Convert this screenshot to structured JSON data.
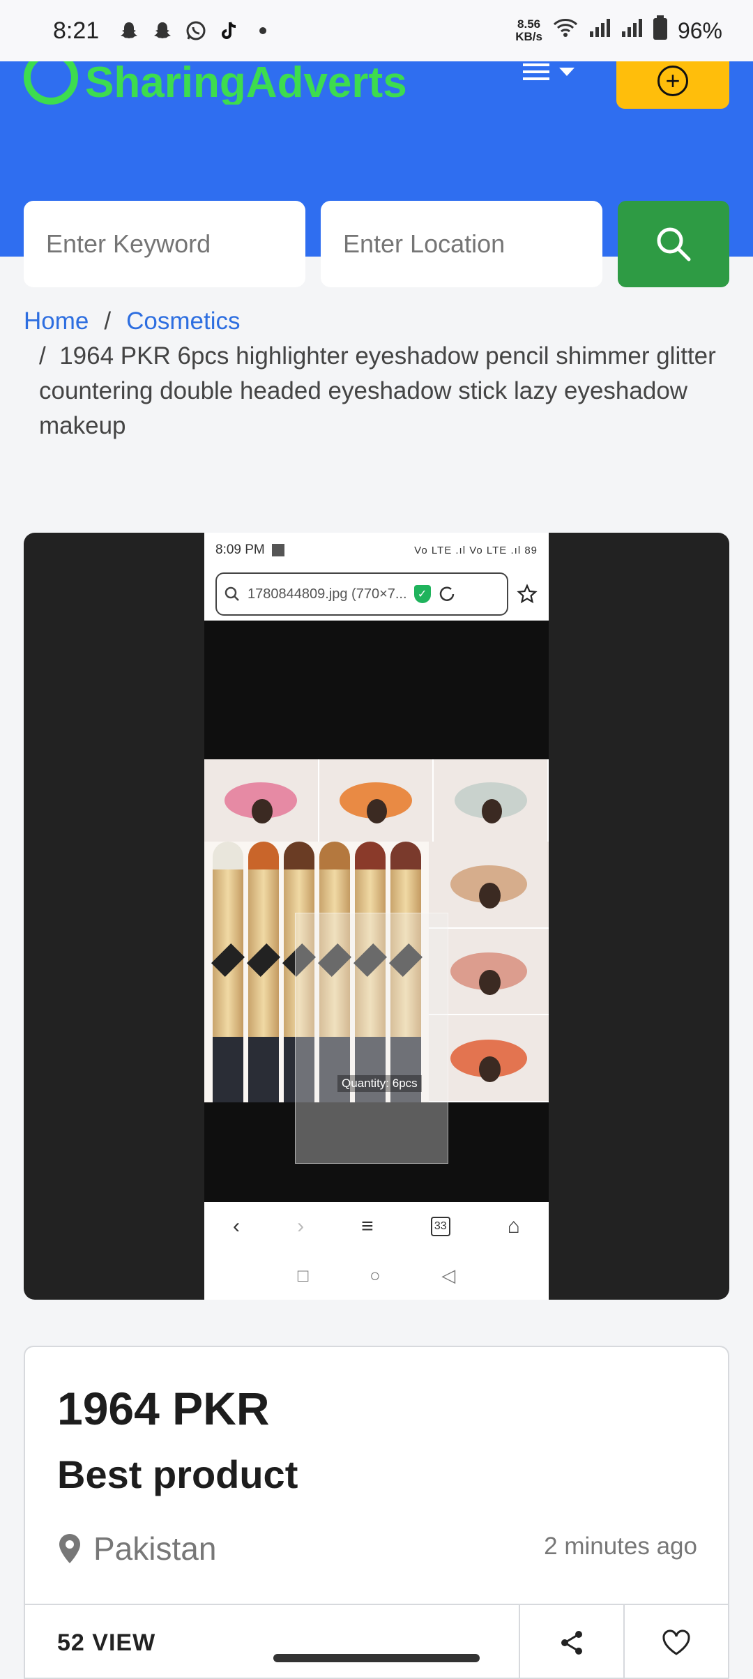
{
  "status_bar": {
    "time": "8:21",
    "net_speed_value": "8.56",
    "net_speed_unit": "KB/s",
    "battery": "96%"
  },
  "header": {
    "logo_text": "SharingAdverts",
    "keyword_placeholder": "Enter Keyword",
    "location_placeholder": "Enter Location",
    "accent": "#2f6ef0",
    "post_button_color": "#ffbe0b",
    "search_button_color": "#2e9b44"
  },
  "breadcrumb": {
    "home": "Home",
    "separator": "/",
    "category": "Cosmetics",
    "current": "1964 PKR 6pcs highlighter eyeshadow pencil shimmer glitter countering double headed eyeshadow stick lazy eyeshadow makeup"
  },
  "gallery": {
    "inner_time": "8:09 PM",
    "inner_status": "Vo LTE .ıl Vo LTE .ıl 89",
    "inner_url": "1780844809.jpg (770×7...",
    "overlay_label": "Quantity: 6pcs",
    "tabs_count": "33"
  },
  "product": {
    "price": "1964 PKR",
    "title": "Best product",
    "location": "Pakistan",
    "posted": "2 minutes ago",
    "views": "52 VIEW"
  }
}
